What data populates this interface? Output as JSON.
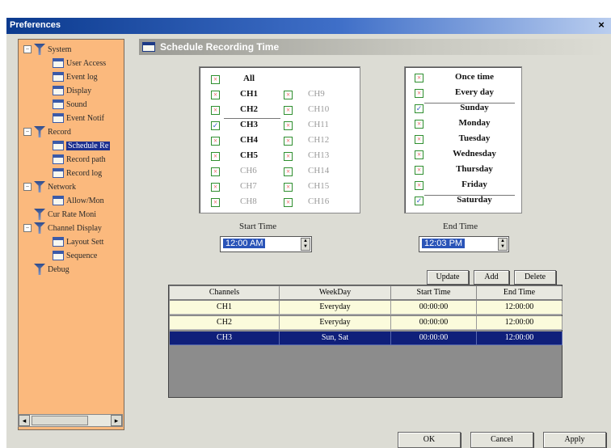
{
  "window": {
    "title": "Preferences",
    "close": "×"
  },
  "sidebar": {
    "items": [
      {
        "label": "System",
        "type": "group",
        "expander": "−"
      },
      {
        "label": "User Access",
        "type": "page"
      },
      {
        "label": "Event log",
        "type": "page"
      },
      {
        "label": "Display",
        "type": "page"
      },
      {
        "label": "Sound",
        "type": "page"
      },
      {
        "label": "Event Notif",
        "type": "page"
      },
      {
        "label": "Record",
        "type": "group",
        "expander": "−"
      },
      {
        "label": "Schedule Re",
        "type": "page",
        "selected": true
      },
      {
        "label": "Record path",
        "type": "page"
      },
      {
        "label": "Record log",
        "type": "page"
      },
      {
        "label": "Network",
        "type": "group",
        "expander": "−"
      },
      {
        "label": "Allow/Mon",
        "type": "page"
      },
      {
        "label": "Cur Rate Moni",
        "type": "group"
      },
      {
        "label": "Channel Display",
        "type": "group",
        "expander": "−"
      },
      {
        "label": "Layout Sett",
        "type": "page"
      },
      {
        "label": "Sequence",
        "type": "page"
      },
      {
        "label": "Debug",
        "type": "group"
      }
    ],
    "scroll_left": "◂",
    "scroll_right": "▸"
  },
  "header": {
    "title": "Schedule Recording Time"
  },
  "channels": {
    "all_label": "All",
    "left": [
      {
        "label": "CH1",
        "state": "x",
        "style": "bold"
      },
      {
        "label": "CH2",
        "state": "x",
        "style": "bold"
      },
      {
        "label": "CH3",
        "state": "v",
        "style": "bold"
      },
      {
        "label": "CH4",
        "state": "x",
        "style": "bold"
      },
      {
        "label": "CH5",
        "state": "x",
        "style": "bold"
      },
      {
        "label": "CH6",
        "state": "x",
        "style": "gray"
      },
      {
        "label": "CH7",
        "state": "x",
        "style": "gray"
      },
      {
        "label": "CH8",
        "state": "x",
        "style": "gray"
      }
    ],
    "right": [
      {
        "label": "CH9",
        "state": "x"
      },
      {
        "label": "CH10",
        "state": "x"
      },
      {
        "label": "CH11",
        "state": "x"
      },
      {
        "label": "CH12",
        "state": "x"
      },
      {
        "label": "CH13",
        "state": "x"
      },
      {
        "label": "CH14",
        "state": "x"
      },
      {
        "label": "CH15",
        "state": "x"
      },
      {
        "label": "CH16",
        "state": "x"
      }
    ]
  },
  "days": [
    {
      "label": "Once time",
      "state": "x"
    },
    {
      "label": "Every day",
      "state": "x"
    },
    {
      "label": "Sunday",
      "state": "v"
    },
    {
      "label": "Monday",
      "state": "x"
    },
    {
      "label": "Tuesday",
      "state": "x"
    },
    {
      "label": "Wednesday",
      "state": "x"
    },
    {
      "label": "Thursday",
      "state": "x"
    },
    {
      "label": "Friday",
      "state": "x"
    },
    {
      "label": "Saturday",
      "state": "v"
    }
  ],
  "start_time": {
    "label": "Start Time",
    "value": "12:00 AM"
  },
  "end_time": {
    "label": "End Time",
    "value": "12:03 PM"
  },
  "actions": {
    "update": "Update",
    "add": "Add",
    "delete": "Delete"
  },
  "table": {
    "columns": [
      "Channels",
      "WeekDay",
      "Start Time",
      "End Time"
    ],
    "rows": [
      {
        "cells": [
          "CH1",
          "Everyday",
          "00:00:00",
          "12:00:00"
        ],
        "selected": false
      },
      {
        "cells": [
          "CH2",
          "Everyday",
          "00:00:00",
          "12:00:00"
        ],
        "selected": false
      },
      {
        "cells": [
          "CH3",
          "Sun, Sat",
          "00:00:00",
          "12:00:00"
        ],
        "selected": true
      }
    ]
  },
  "footer": {
    "ok": "OK",
    "cancel": "Cancel",
    "apply": "Apply"
  },
  "colors": {
    "sidebar_bg": "#fbb97d",
    "selection": "#0f1f7a",
    "row_bg": "#fbfbdc",
    "check_x": "#e84040",
    "check_v": "#3a5fc8"
  }
}
